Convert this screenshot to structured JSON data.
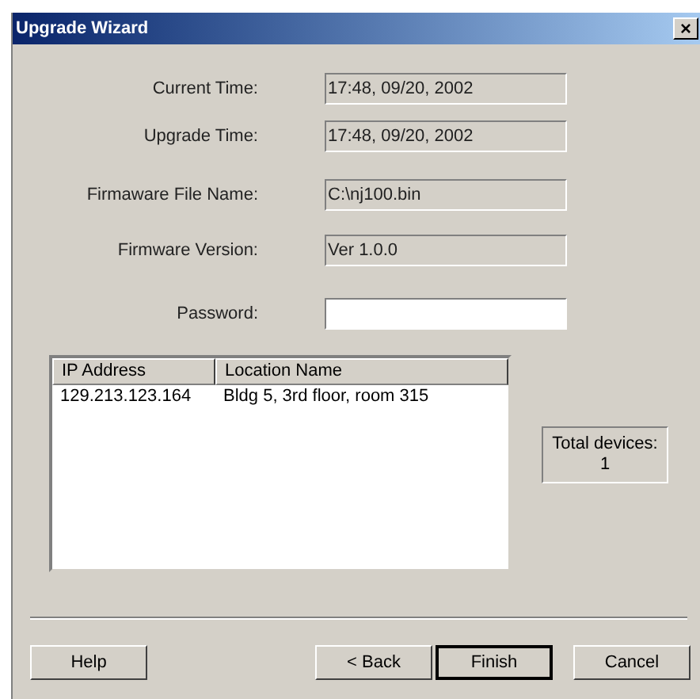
{
  "window": {
    "title": "Upgrade Wizard",
    "close": "×"
  },
  "fields": [
    {
      "label": "Current Time:",
      "value": "17:48, 09/20, 2002",
      "readonly": true
    },
    {
      "label": "Upgrade Time:",
      "value": "17:48, 09/20, 2002",
      "readonly": true
    },
    {
      "label": "Firmaware File Name:",
      "value": "C:\\nj100.bin",
      "readonly": true
    },
    {
      "label": "Firmware Version:",
      "value": "Ver 1.0.0",
      "readonly": true
    },
    {
      "label": "Password:",
      "readonly": false
    }
  ],
  "table": {
    "columns": [
      "IP Address",
      "Location Name"
    ],
    "rows": [
      [
        "129.213.123.164",
        "Bldg 5, 3rd floor, room 315"
      ]
    ]
  },
  "total": {
    "label": "Total devices:",
    "value": "1"
  },
  "buttons": [
    {
      "label": "Help",
      "default": false
    },
    {
      "label": "< Back",
      "default": false
    },
    {
      "label": "Finish",
      "default": true
    },
    {
      "label": "Cancel",
      "default": false
    }
  ]
}
